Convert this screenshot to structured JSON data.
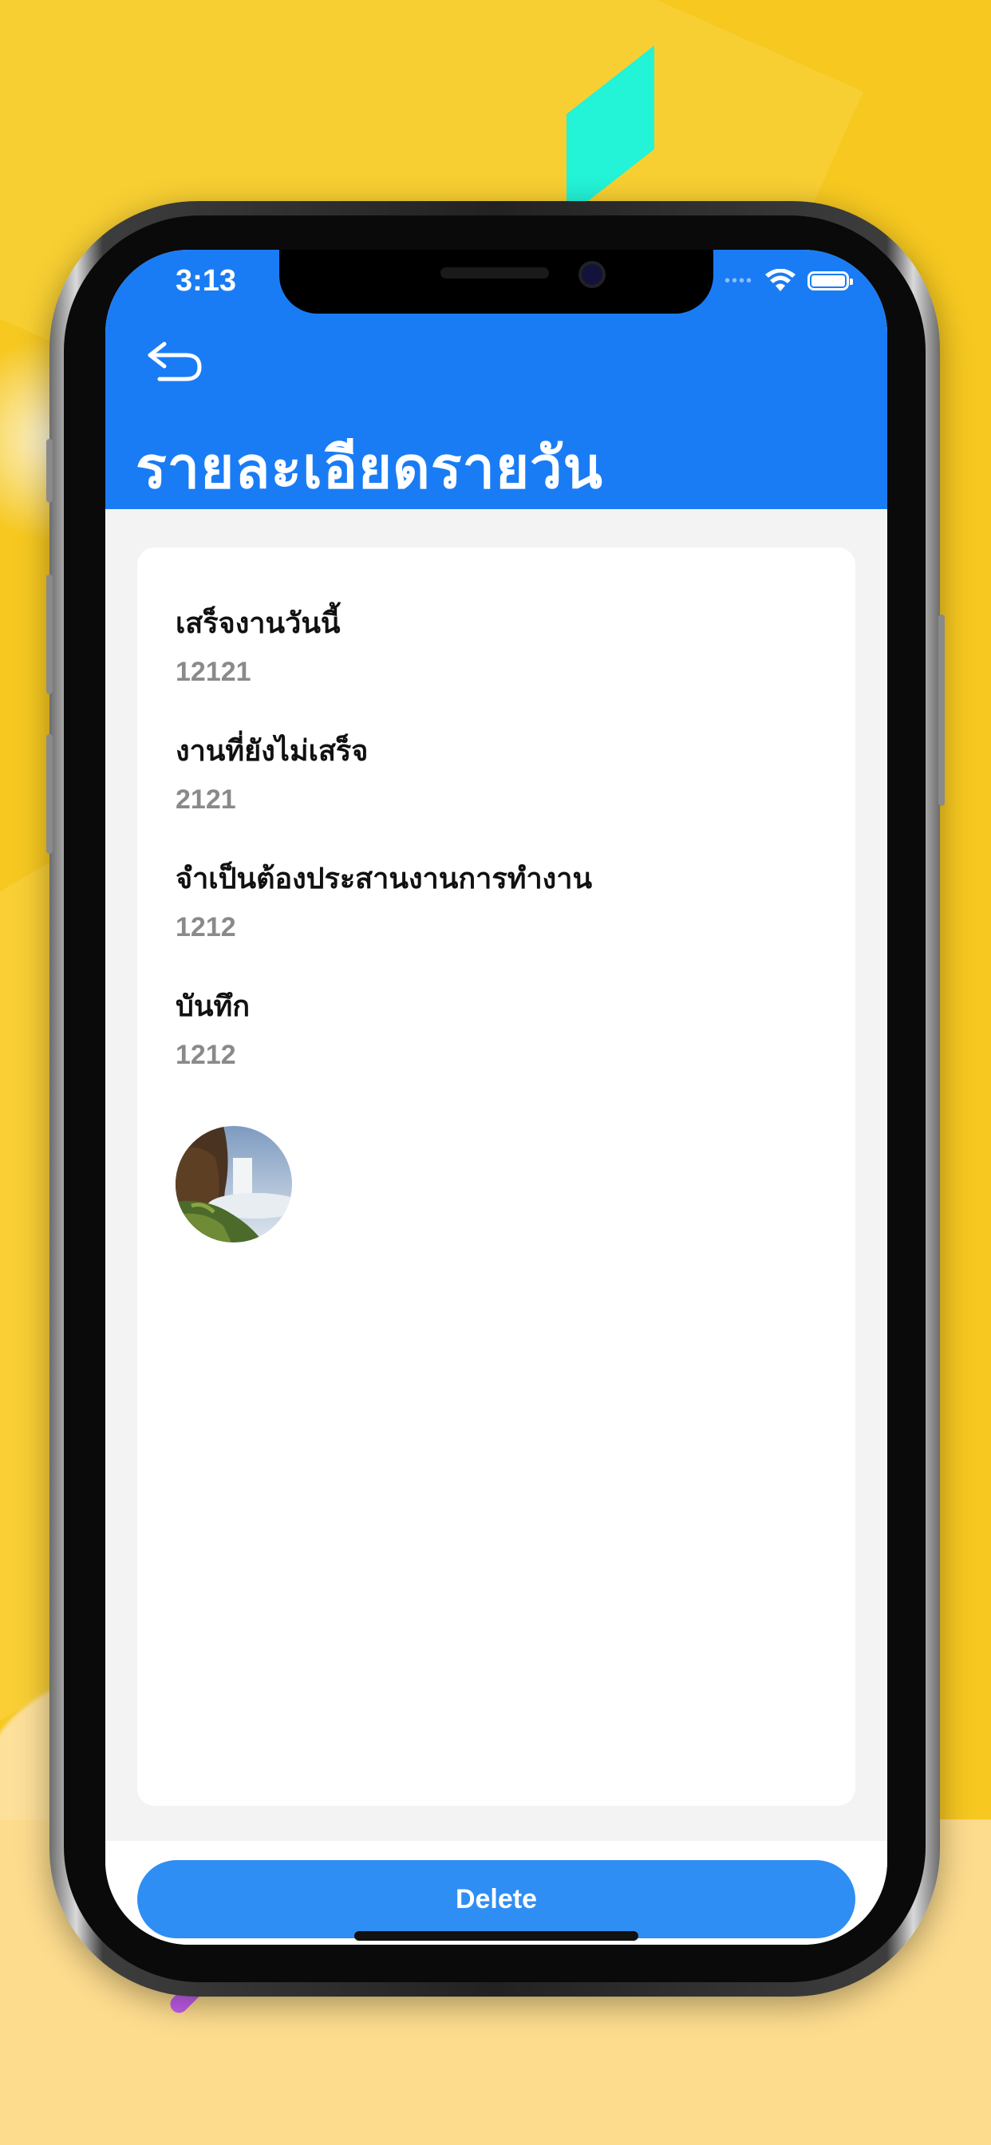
{
  "status_bar": {
    "time": "3:13"
  },
  "header": {
    "title": "รายละเอียดรายวัน"
  },
  "details": {
    "fields": [
      {
        "label": "เสร็จงานวันนี้",
        "value": "12121"
      },
      {
        "label": "งานที่ยังไม่เสร็จ",
        "value": "2121"
      },
      {
        "label": "จำเป็นต้องประสานงานการทำงาน",
        "value": "1212"
      },
      {
        "label": "บันทึก",
        "value": "1212"
      }
    ]
  },
  "actions": {
    "delete_label": "Delete"
  },
  "icons": {
    "back": "back-arrow-icon",
    "wifi": "wifi-icon",
    "battery": "battery-icon"
  },
  "colors": {
    "header": "#1a7cf5",
    "delete_button": "#2f8ef3",
    "background": "#f6c820"
  }
}
